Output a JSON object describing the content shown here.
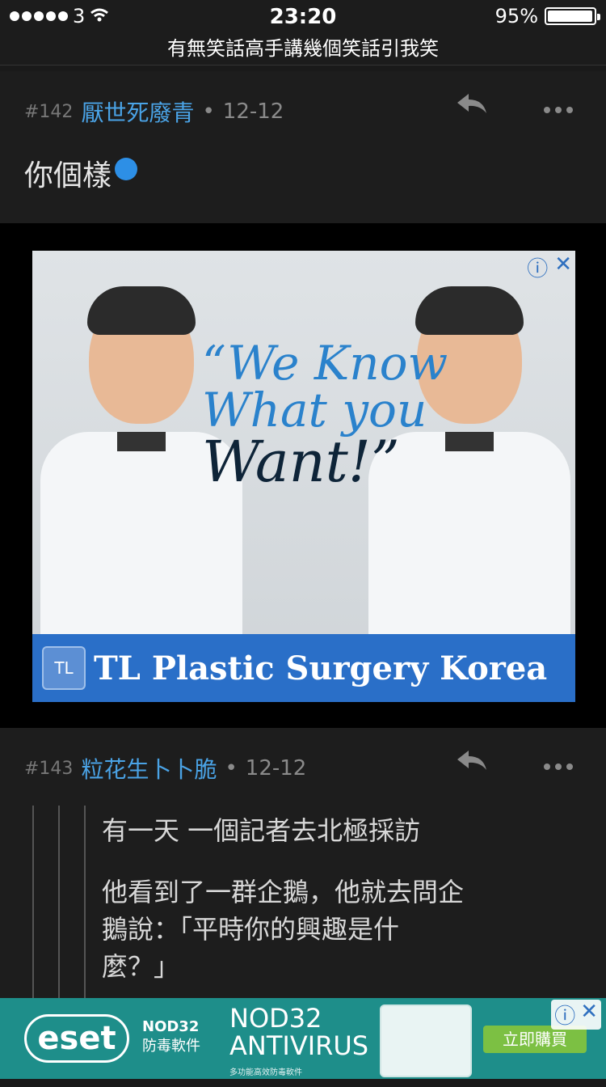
{
  "status": {
    "carrier": "3",
    "time": "23:20",
    "battery": "95%"
  },
  "title": "有無笑話高手講幾個笑話引我笑",
  "posts": [
    {
      "num": "#142",
      "user": "厭世死廢青",
      "date": "12-12",
      "content": "你個樣"
    },
    {
      "num": "#143",
      "user": "粒花生卜卜脆",
      "date": "12-12",
      "quote_lines": [
        "有一天 一個記者去北極採訪",
        "他看到了一群企鵝，他就去問企",
        "鵝說：「平時你的興趣是什",
        "麼？」"
      ]
    }
  ],
  "ad": {
    "quote_lines": [
      "“We Know",
      "What you",
      "Want!”"
    ],
    "brand": "TL Plastic Surgery Korea",
    "logo": "TL"
  },
  "bottom_ad": {
    "eset": "eset",
    "nod_lines": [
      "NOD32",
      "防毒軟件"
    ],
    "headline": [
      "NOD32",
      "ANTIVIRUS"
    ],
    "sub": "多功能高效防毒軟件",
    "cta": "立即購買"
  },
  "colors": {
    "accent": "#4aa3e6",
    "background": "#1a1a1a"
  }
}
